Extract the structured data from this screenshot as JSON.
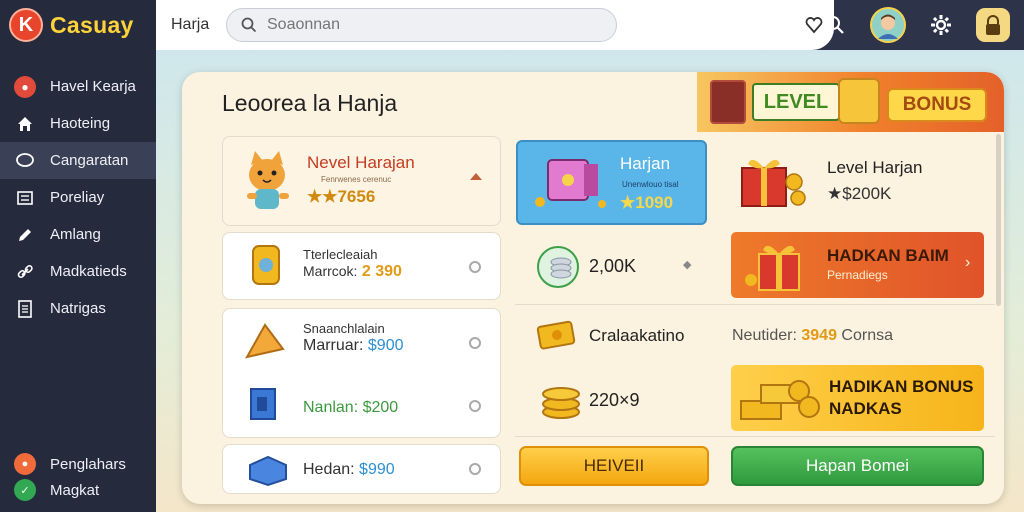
{
  "app": {
    "name": "Casuay",
    "logo_letter": "K"
  },
  "sidebar": {
    "items": [
      {
        "label": "Havel Kearja",
        "icon": "gamepad-icon"
      },
      {
        "label": "Haoteing",
        "icon": "home-icon"
      },
      {
        "label": "Cangaratan",
        "icon": "chat-icon",
        "active": true
      },
      {
        "label": "Poreliay",
        "icon": "list-icon"
      },
      {
        "label": "Amlang",
        "icon": "pencil-icon"
      },
      {
        "label": "Madkatieds",
        "icon": "link-icon"
      },
      {
        "label": "Natrigas",
        "icon": "document-icon"
      }
    ],
    "bottom_items": [
      {
        "label": "Penglahars",
        "icon": "orange-coin-icon"
      },
      {
        "label": "Magkat",
        "icon": "check-icon"
      }
    ]
  },
  "topbar": {
    "title": "Harja",
    "search_placeholder": "Soaonnan",
    "icons": [
      "search-icon",
      "avatar",
      "gear-icon",
      "lock-icon"
    ]
  },
  "panel": {
    "title": "Leoorea la Hanja",
    "banner": {
      "level": "LEVEL",
      "bonus": "BONUS"
    },
    "featured": {
      "name": "Nevel Harajan",
      "sub": "Fenrwenes cerenuc",
      "rating": "★★7656"
    },
    "left_cards": [
      {
        "title": "Tterlecleaiah",
        "price_label": "Marrcok:",
        "price": "2 390"
      },
      {
        "title": "Snaanchlalain",
        "price_label": "Marruar:",
        "price": "$900"
      },
      {
        "price_label": "Nanlan:",
        "price": "$200"
      },
      {
        "price_label": "Hedan:",
        "price": "$990"
      }
    ],
    "highlight": {
      "title": "Harjan",
      "sub": "Unenwlouo tisal",
      "rating": "★1090"
    },
    "level_card": {
      "title": "Level Harjan",
      "value": "★$200K"
    },
    "mid": [
      {
        "value": "2,00K"
      },
      {
        "value": "Cralaakatino"
      },
      {
        "value": "220×9"
      }
    ],
    "promos": [
      {
        "title": "HADKAN BAIM",
        "sub": "Pernadiegs"
      },
      {
        "note_label": "Neutider:",
        "note_value": "3949",
        "note_suffix": "Cornsa"
      },
      {
        "title": "HADIKAN BONUS",
        "sub": "NADKAS"
      }
    ],
    "buttons": {
      "left": "HEIVEII",
      "right": "Hapan Bomei"
    }
  },
  "colors": {
    "accent": "#f4a70f",
    "green": "#2f9a3d",
    "sidebar": "#252a3d",
    "brand": "#ffd23a"
  }
}
